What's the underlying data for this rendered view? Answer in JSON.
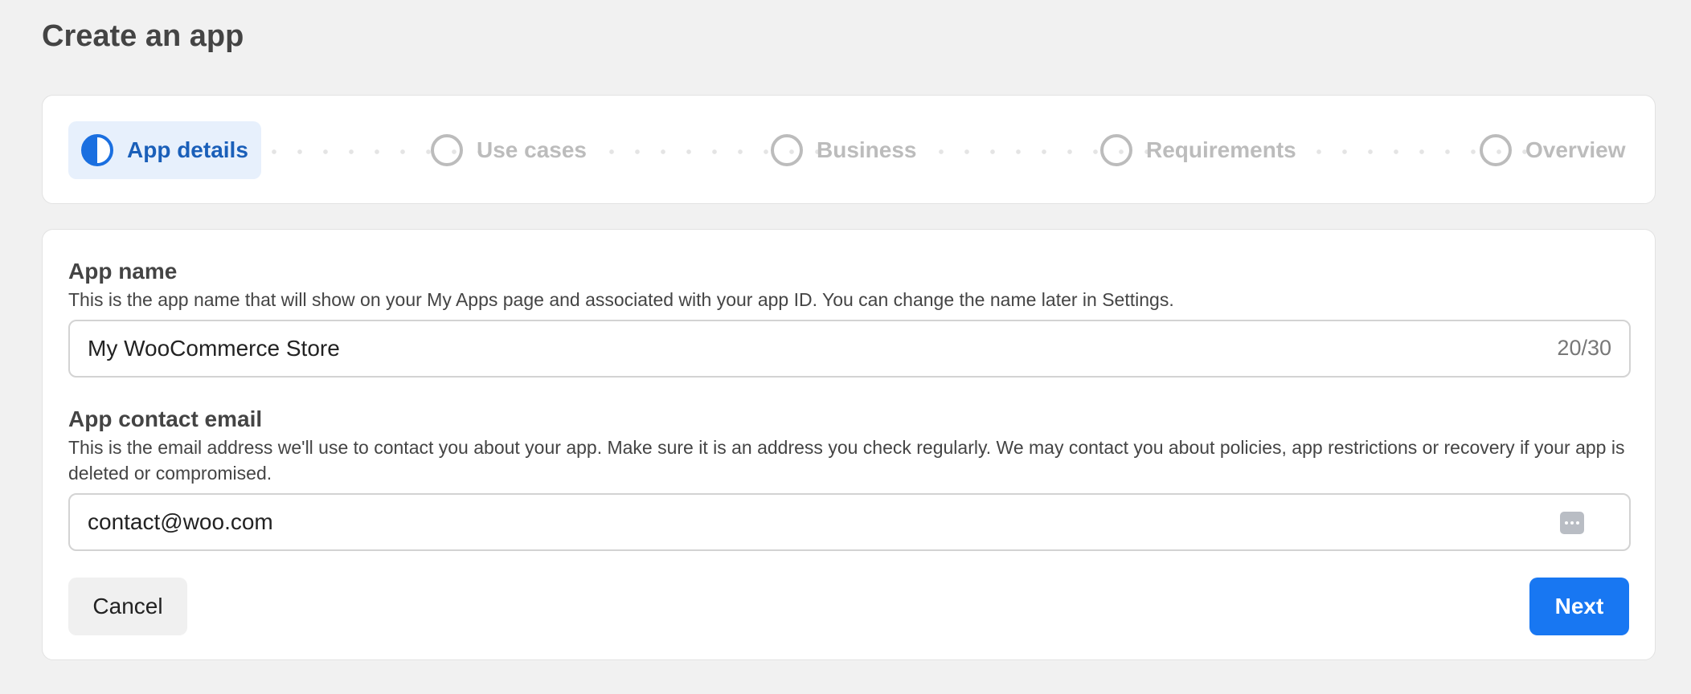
{
  "page": {
    "title": "Create an app"
  },
  "stepper": {
    "steps": [
      {
        "label": "App details",
        "state": "active"
      },
      {
        "label": "Use cases",
        "state": "inactive"
      },
      {
        "label": "Business",
        "state": "inactive"
      },
      {
        "label": "Requirements",
        "state": "inactive"
      },
      {
        "label": "Overview",
        "state": "inactive"
      }
    ]
  },
  "form": {
    "app_name": {
      "label": "App name",
      "help": "This is the app name that will show on your My Apps page and associated with your app ID. You can change the name later in Settings.",
      "value": "My WooCommerce Store",
      "counter": "20/30"
    },
    "contact_email": {
      "label": "App contact email",
      "help": "This is the email address we'll use to contact you about your app. Make sure it is an address you check regularly. We may contact you about policies, app restrictions or recovery if your app is deleted or compromised.",
      "value": "contact@woo.com",
      "icon": "more-options-icon"
    }
  },
  "actions": {
    "cancel_label": "Cancel",
    "next_label": "Next"
  },
  "colors": {
    "accent": "#1877f2",
    "active_step_bg": "#e7f0fc",
    "active_step_text": "#1a5fb9",
    "inactive": "#bcbcbc"
  }
}
